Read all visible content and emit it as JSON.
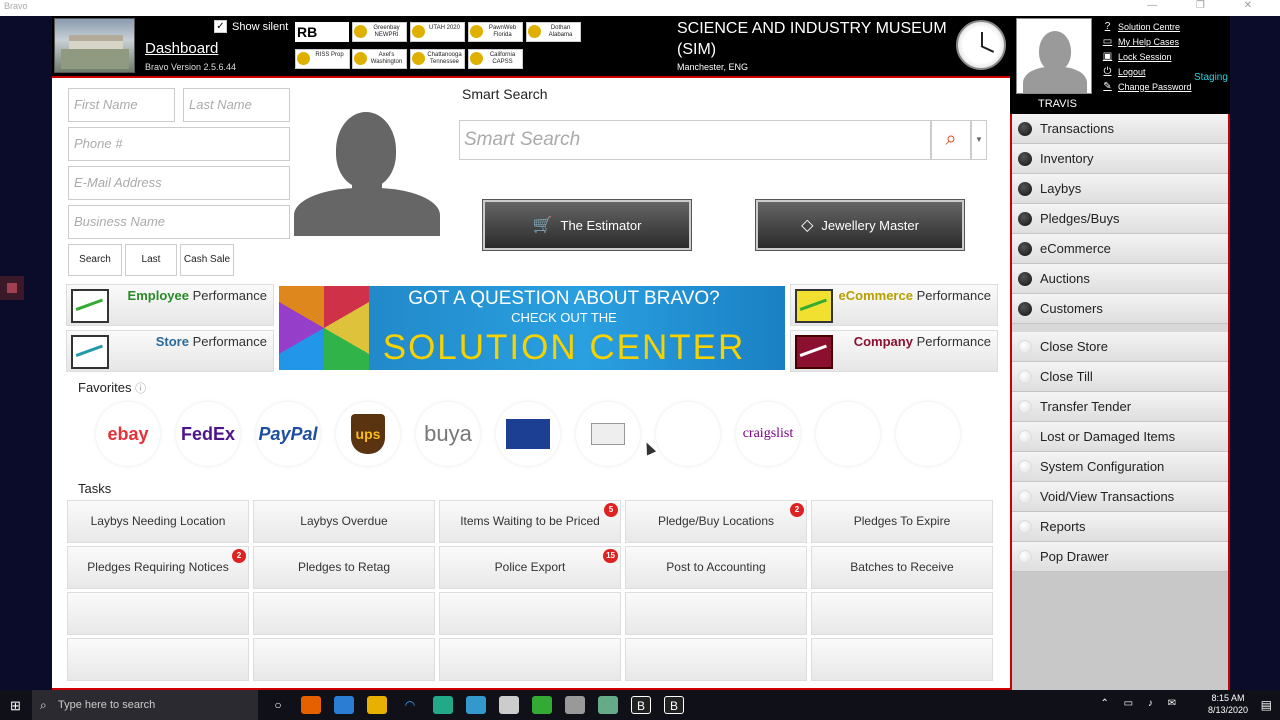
{
  "window": {
    "title": "Bravo",
    "controls": "— ❐ ✕"
  },
  "header": {
    "dashboard_label": "Dashboard",
    "version": "Bravo Version 2.5.6.44",
    "show_silent_label": "Show silent",
    "show_silent_checked": true,
    "rb_label": "RB",
    "store_tiles": [
      "Greenbay NEWPRI",
      "UTAH 2020",
      "PawnWeb Florida",
      "Dothan Alabama",
      "RISS Prop",
      "Axel's Washington",
      "Chattanooga Tennessee",
      "California CAPSS"
    ],
    "museum_name": "SCIENCE AND INDUSTRY MUSEUM (SIM)",
    "city": "Manchester, ENG"
  },
  "user": {
    "name": "TRAVIS",
    "links": [
      "Solution Centre",
      "My Help Cases",
      "Lock Session",
      "Logout",
      "Change Password"
    ],
    "environment": "Staging"
  },
  "customer_form": {
    "first_name_placeholder": "First Name",
    "last_name_placeholder": "Last Name",
    "phone_placeholder": "Phone #",
    "email_placeholder": "E-Mail Address",
    "business_placeholder": "Business Name",
    "search_btn": "Search",
    "last_btn": "Last",
    "cash_sale_btn": "Cash Sale"
  },
  "smart_search": {
    "label": "Smart Search",
    "placeholder": "Smart Search"
  },
  "actions": {
    "estimator": "The Estimator",
    "jewellery": "Jewellery Master"
  },
  "performance": {
    "employee_bold": "Employee",
    "employee_rest": " Performance",
    "store_bold": "Store",
    "store_rest": " Performance",
    "ecommerce_bold": "eCommerce",
    "ecommerce_rest": " Performance",
    "company_bold": "Company",
    "company_rest": " Performance"
  },
  "banner": {
    "line1": "GOT A QUESTION ABOUT BRAVO?",
    "line2": "CHECK OUT THE",
    "line3": "SOLUTION CENTER"
  },
  "favorites": {
    "label": "Favorites",
    "items": [
      "ebay",
      "FedEx",
      "PayPal",
      "ups",
      "buya",
      "",
      "",
      "",
      "craigslist"
    ]
  },
  "tasks": {
    "label": "Tasks",
    "items": [
      {
        "label": "Laybys Needing Location",
        "count": ""
      },
      {
        "label": "Laybys Overdue",
        "count": ""
      },
      {
        "label": "Items Waiting to be Priced",
        "count": "5"
      },
      {
        "label": "Pledge/Buy Locations",
        "count": "2"
      },
      {
        "label": "Pledges To Expire",
        "count": ""
      },
      {
        "label": "Pledges Requiring Notices",
        "count": "2"
      },
      {
        "label": "Pledges to Retag",
        "count": ""
      },
      {
        "label": "Police Export",
        "count": "15"
      },
      {
        "label": "Post to Accounting",
        "count": ""
      },
      {
        "label": "Batches to Receive",
        "count": ""
      }
    ]
  },
  "sidebar": {
    "modules": [
      "Transactions",
      "Inventory",
      "Laybys",
      "Pledges/Buys",
      "eCommerce",
      "Auctions",
      "Customers"
    ],
    "tools": [
      "Close Store",
      "Close Till",
      "Transfer Tender",
      "Lost or Damaged Items",
      "System Configuration",
      "Void/View Transactions",
      "Reports",
      "Pop Drawer"
    ]
  },
  "taskbar": {
    "search_placeholder": "Type here to search",
    "time": "8:15 AM",
    "date": "8/13/2020"
  }
}
